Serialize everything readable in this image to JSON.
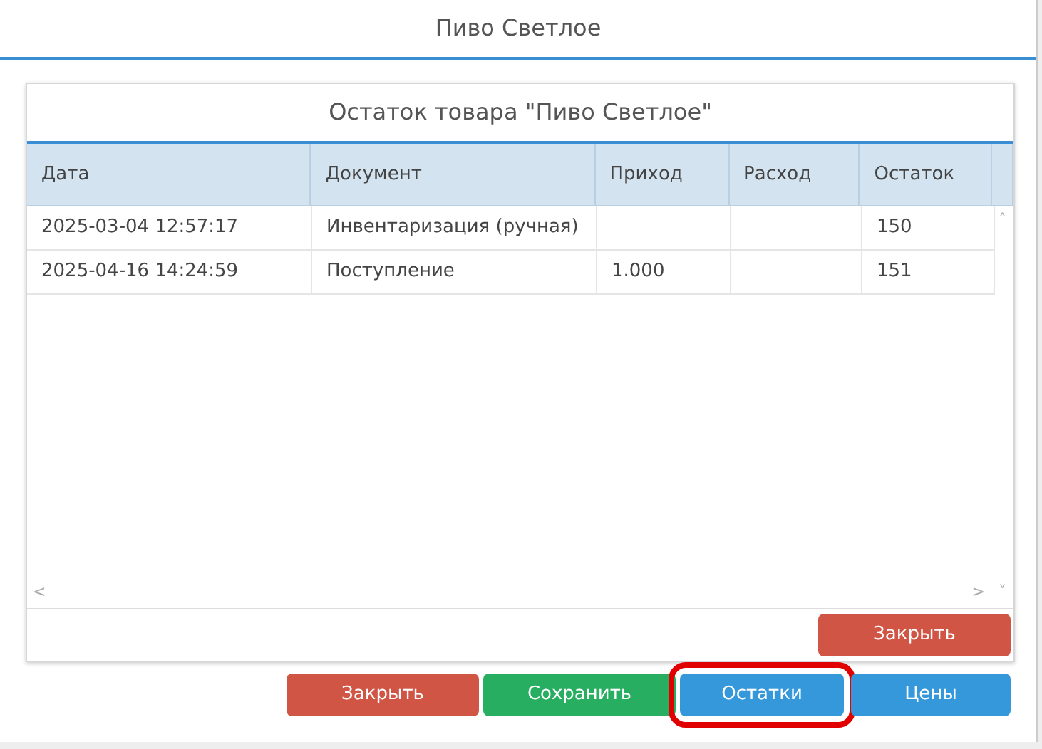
{
  "window": {
    "title": "Пиво Светлое"
  },
  "panel": {
    "title": "Остаток товара \"Пиво Светлое\"",
    "table": {
      "columns": [
        "Дата",
        "Документ",
        "Приход",
        "Расход",
        "Остаток"
      ],
      "rows": [
        [
          "2025-03-04 12:57:17",
          "Инвентаризация (ручная)",
          "",
          "",
          "150"
        ],
        [
          "2025-04-16 14:24:59",
          "Поступление",
          "1.000",
          "",
          "151"
        ]
      ]
    },
    "scroll_icons": {
      "up": "˄",
      "left": "<",
      "right": ">",
      "down": "˅"
    },
    "buttons": [
      {
        "label": "Закрыть",
        "kind": "danger"
      }
    ]
  },
  "buttons": [
    {
      "label": "Закрыть",
      "kind": "danger",
      "highlighted": false
    },
    {
      "label": "Сохранить",
      "kind": "success",
      "highlighted": false
    },
    {
      "label": "Остатки",
      "kind": "primary",
      "highlighted": true
    },
    {
      "label": "Цены",
      "kind": "primary",
      "highlighted": false
    }
  ]
}
